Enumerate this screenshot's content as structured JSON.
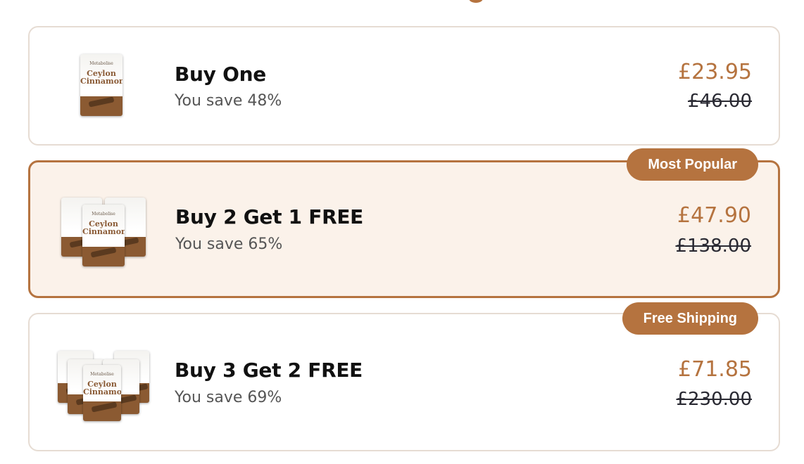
{
  "offers": [
    {
      "title": "Buy One",
      "saving": "You save 48%",
      "price": "£23.95",
      "old_price": "£46.00",
      "selected": false,
      "badge": ""
    },
    {
      "title": "Buy 2 Get 1 FREE",
      "saving": "You save 65%",
      "price": "£47.90",
      "old_price": "£138.00",
      "selected": true,
      "badge": "Most Popular"
    },
    {
      "title": "Buy 3 Get 2 FREE",
      "saving": "You save 69%",
      "price": "£71.85",
      "old_price": "£230.00",
      "selected": false,
      "badge": "Free Shipping"
    }
  ],
  "product": {
    "brand": "Metabolise",
    "name": "Ceylon Cinnamon"
  },
  "colors": {
    "accent": "#b5733f",
    "selected_bg": "#fbf2ea",
    "border": "#e6dcd3",
    "title": "#111111",
    "muted": "#555555"
  }
}
